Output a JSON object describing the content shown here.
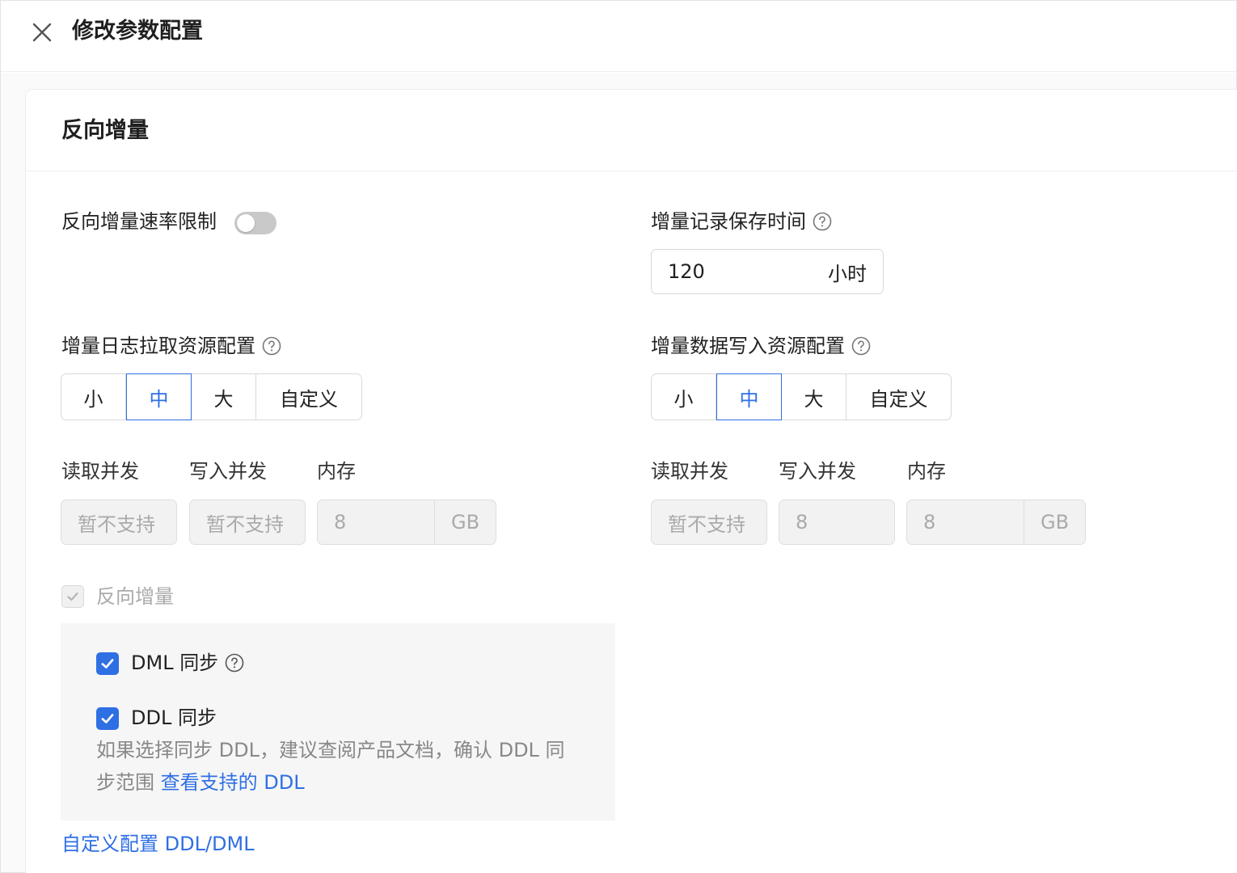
{
  "header": {
    "title": "修改参数配置"
  },
  "section": {
    "title": "反向增量"
  },
  "rate_limit": {
    "label": "反向增量速率限制",
    "enabled": false
  },
  "retention": {
    "label": "增量记录保存时间",
    "value": "120",
    "unit": "小时"
  },
  "pull_resource": {
    "label": "增量日志拉取资源配置",
    "options": [
      "小",
      "中",
      "大",
      "自定义"
    ],
    "selected": "中",
    "fields": [
      {
        "label": "读取并发",
        "value": "暂不支持"
      },
      {
        "label": "写入并发",
        "value": "暂不支持"
      },
      {
        "label": "内存",
        "value": "8",
        "unit": "GB"
      }
    ]
  },
  "write_resource": {
    "label": "增量数据写入资源配置",
    "options": [
      "小",
      "中",
      "大",
      "自定义"
    ],
    "selected": "中",
    "fields": [
      {
        "label": "读取并发",
        "value": "暂不支持"
      },
      {
        "label": "写入并发",
        "value": "8"
      },
      {
        "label": "内存",
        "value": "8",
        "unit": "GB"
      }
    ]
  },
  "reverse_increment": {
    "label": "反向增量",
    "checked": true,
    "dml": {
      "label": "DML 同步",
      "checked": true
    },
    "ddl": {
      "label": "DDL 同步",
      "checked": true
    },
    "ddl_desc": "如果选择同步 DDL，建议查阅产品文档，确认 DDL 同",
    "ddl_desc_line2": "步范围",
    "ddl_link": "查看支持的 DDL"
  },
  "custom_link": "自定义配置 DDL/DML",
  "colors": {
    "accent": "#2f6fe4",
    "toggle_off": "#c9c9c9",
    "disabled_bg": "#f2f2f2"
  }
}
